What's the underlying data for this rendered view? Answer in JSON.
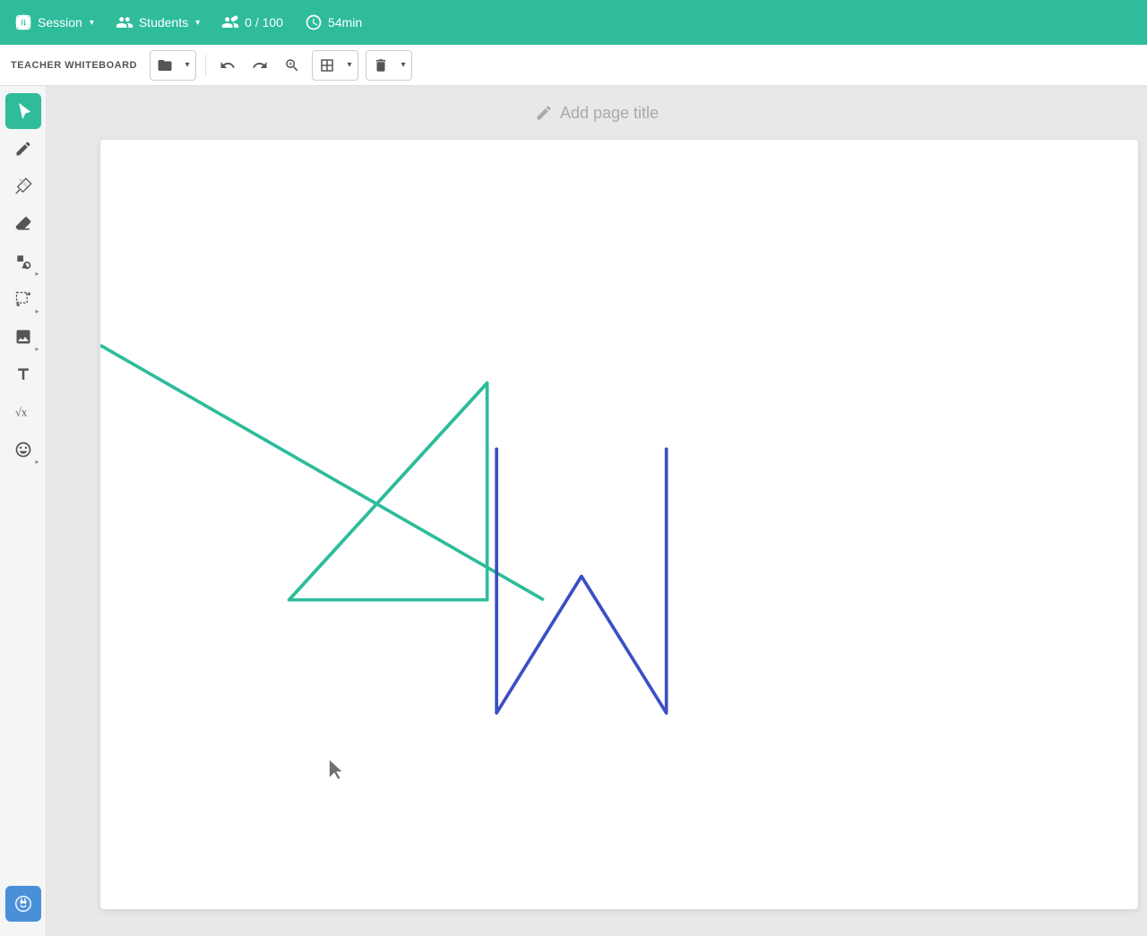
{
  "topbar": {
    "session_label": "Session",
    "students_label": "Students",
    "participants_count": "0 / 100",
    "timer": "54min"
  },
  "toolbar": {
    "label": "TEACHER WHITEBOARD",
    "undo_title": "Undo",
    "redo_title": "Redo",
    "zoom_title": "Zoom",
    "grid_title": "Grid",
    "delete_title": "Delete"
  },
  "page_title": {
    "placeholder": "Add page title",
    "pencil_icon": "✏"
  },
  "tools": [
    {
      "id": "select",
      "icon": "cursor",
      "label": "Select",
      "active": true
    },
    {
      "id": "pen",
      "icon": "pen",
      "label": "Pen",
      "active": false
    },
    {
      "id": "highlight",
      "icon": "highlight",
      "label": "Highlighter",
      "active": false
    },
    {
      "id": "eraser",
      "icon": "eraser",
      "label": "Eraser",
      "active": false
    },
    {
      "id": "shapes",
      "icon": "shapes",
      "label": "Shapes",
      "active": false,
      "has_arrow": true
    },
    {
      "id": "transform",
      "icon": "transform",
      "label": "Transform",
      "active": false,
      "has_arrow": true
    },
    {
      "id": "image",
      "icon": "image",
      "label": "Insert Image",
      "active": false,
      "has_arrow": true
    },
    {
      "id": "text",
      "icon": "text",
      "label": "Text",
      "active": false
    },
    {
      "id": "math",
      "icon": "math",
      "label": "Math",
      "active": false
    },
    {
      "id": "emoji",
      "icon": "emoji",
      "label": "Emoji",
      "active": false,
      "has_arrow": true
    }
  ],
  "colors": {
    "green": "#2ebc9b",
    "blue": "#3b4fc4",
    "toolbar_bg": "#2ebc9b",
    "ai_btn": "#4a90d9"
  }
}
